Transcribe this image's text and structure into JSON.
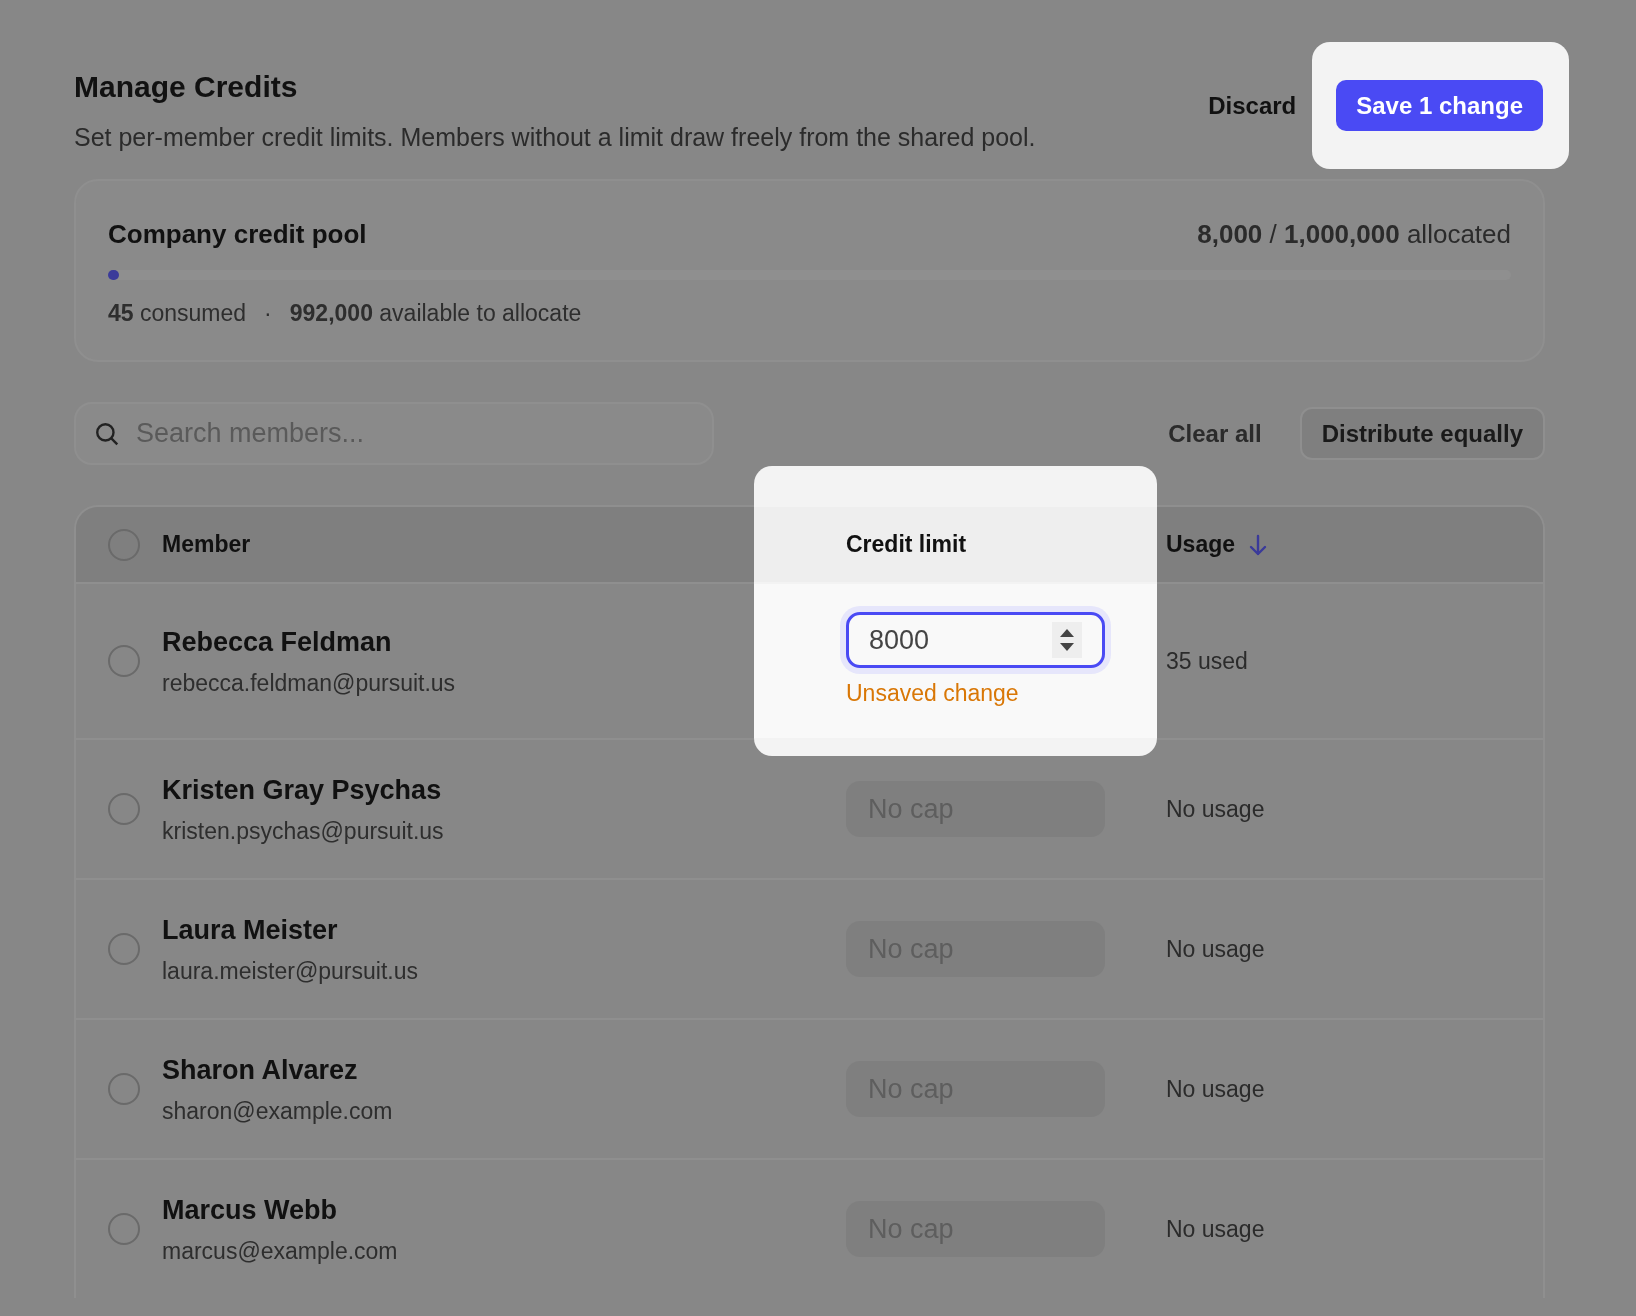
{
  "header": {
    "title": "Manage Credits",
    "subtitle": "Set per-member credit limits. Members without a limit draw freely from the shared pool."
  },
  "actions": {
    "discard": "Discard",
    "save": "Save 1 change",
    "highlighted": true
  },
  "pool": {
    "title": "Company credit pool",
    "allocated": "**8,000** / **1,000,000** allocated",
    "level": 0.008,
    "consumed": "**45** consumed",
    "separator": "·",
    "available": "**992,000** available to allocate"
  },
  "search": {
    "placeholder": "Search members..."
  },
  "toolbar": {
    "clear": "Clear all",
    "distribute": "Distribute equally"
  },
  "table": {
    "select_all": {
      "checked": false
    },
    "columns": [
      {
        "label": "Member",
        "sorted": false
      },
      {
        "label": "Credit limit",
        "sorted": false
      },
      {
        "label": "Usage",
        "sorted": true
      }
    ],
    "rows": [
      {
        "name": "Rebecca Feldman",
        "email": "rebecca.feldman@pursuit.us",
        "checked": false,
        "focused": true,
        "limit": "8000",
        "note": "Unsaved change",
        "usage": "35 used"
      },
      {
        "name": "Kristen Gray Psychas",
        "email": "kristen.psychas@pursuit.us",
        "checked": false,
        "focused": false,
        "placeholder": "No cap",
        "usage": "No usage"
      },
      {
        "name": "Laura Meister",
        "email": "laura.meister@pursuit.us",
        "checked": false,
        "focused": false,
        "placeholder": "No cap",
        "usage": "No usage"
      },
      {
        "name": "Sharon Alvarez",
        "email": "sharon@example.com",
        "checked": false,
        "focused": false,
        "placeholder": "No cap",
        "usage": "No usage"
      },
      {
        "name": "Marcus Webb",
        "email": "marcus@example.com",
        "checked": false,
        "focused": false,
        "placeholder": "No cap",
        "usage": "No usage"
      }
    ]
  }
}
